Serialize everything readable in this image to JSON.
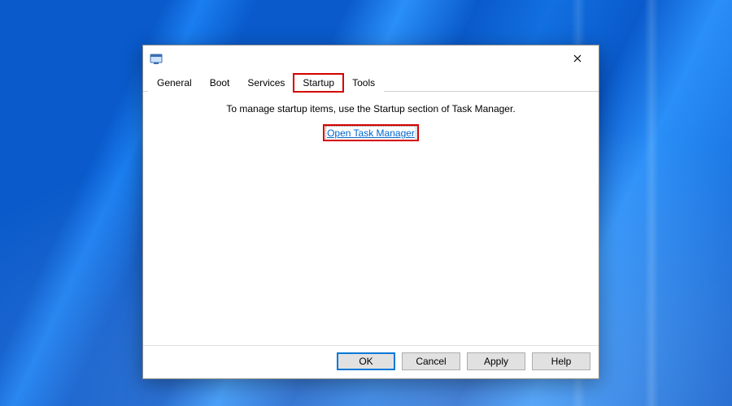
{
  "window": {
    "title": ""
  },
  "tabs": {
    "general": "General",
    "boot": "Boot",
    "services": "Services",
    "startup": "Startup",
    "tools": "Tools",
    "active": "startup"
  },
  "content": {
    "info": "To manage startup items, use the Startup section of Task Manager.",
    "link": "Open Task Manager"
  },
  "buttons": {
    "ok": "OK",
    "cancel": "Cancel",
    "apply": "Apply",
    "help": "Help"
  }
}
